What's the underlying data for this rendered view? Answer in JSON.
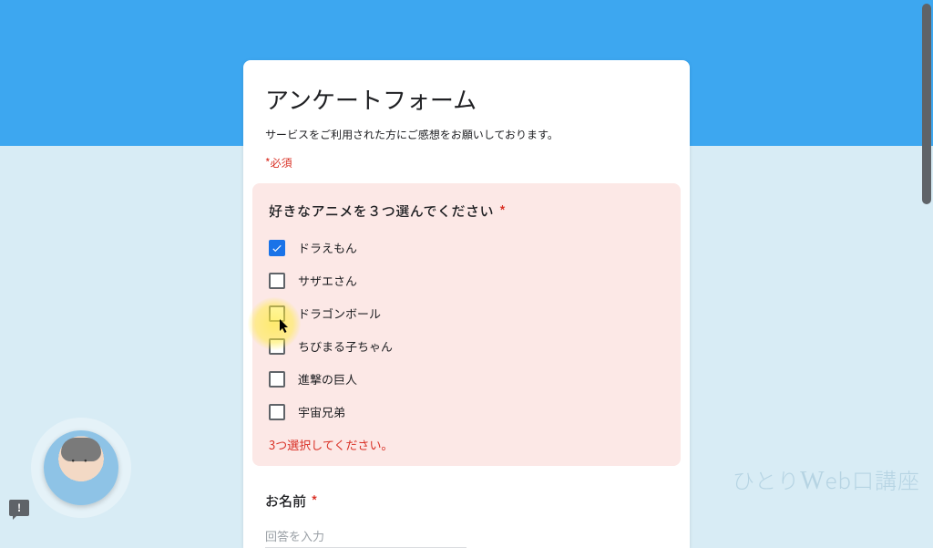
{
  "header": {
    "title": "アンケートフォーム",
    "description": "サービスをご利用された方にご感想をお願いしております。",
    "required_label": "*必須"
  },
  "question1": {
    "title": "好きなアニメを３つ選んでください",
    "asterisk": "*",
    "options": [
      {
        "label": "ドラえもん",
        "checked": true
      },
      {
        "label": "サザエさん",
        "checked": false
      },
      {
        "label": "ドラゴンボール",
        "checked": false
      },
      {
        "label": "ちびまる子ちゃん",
        "checked": false
      },
      {
        "label": "進撃の巨人",
        "checked": false
      },
      {
        "label": "宇宙兄弟",
        "checked": false
      }
    ],
    "error": "3つ選択してください。"
  },
  "question2": {
    "title": "お名前",
    "asterisk": "*",
    "placeholder": "回答を入力"
  },
  "watermark": "ひとりWeb口講座",
  "feedback_icon": "!",
  "colors": {
    "accent": "#3da7f0",
    "primary": "#1a73e8",
    "error": "#d93025",
    "error_bg": "#fce8e6"
  }
}
